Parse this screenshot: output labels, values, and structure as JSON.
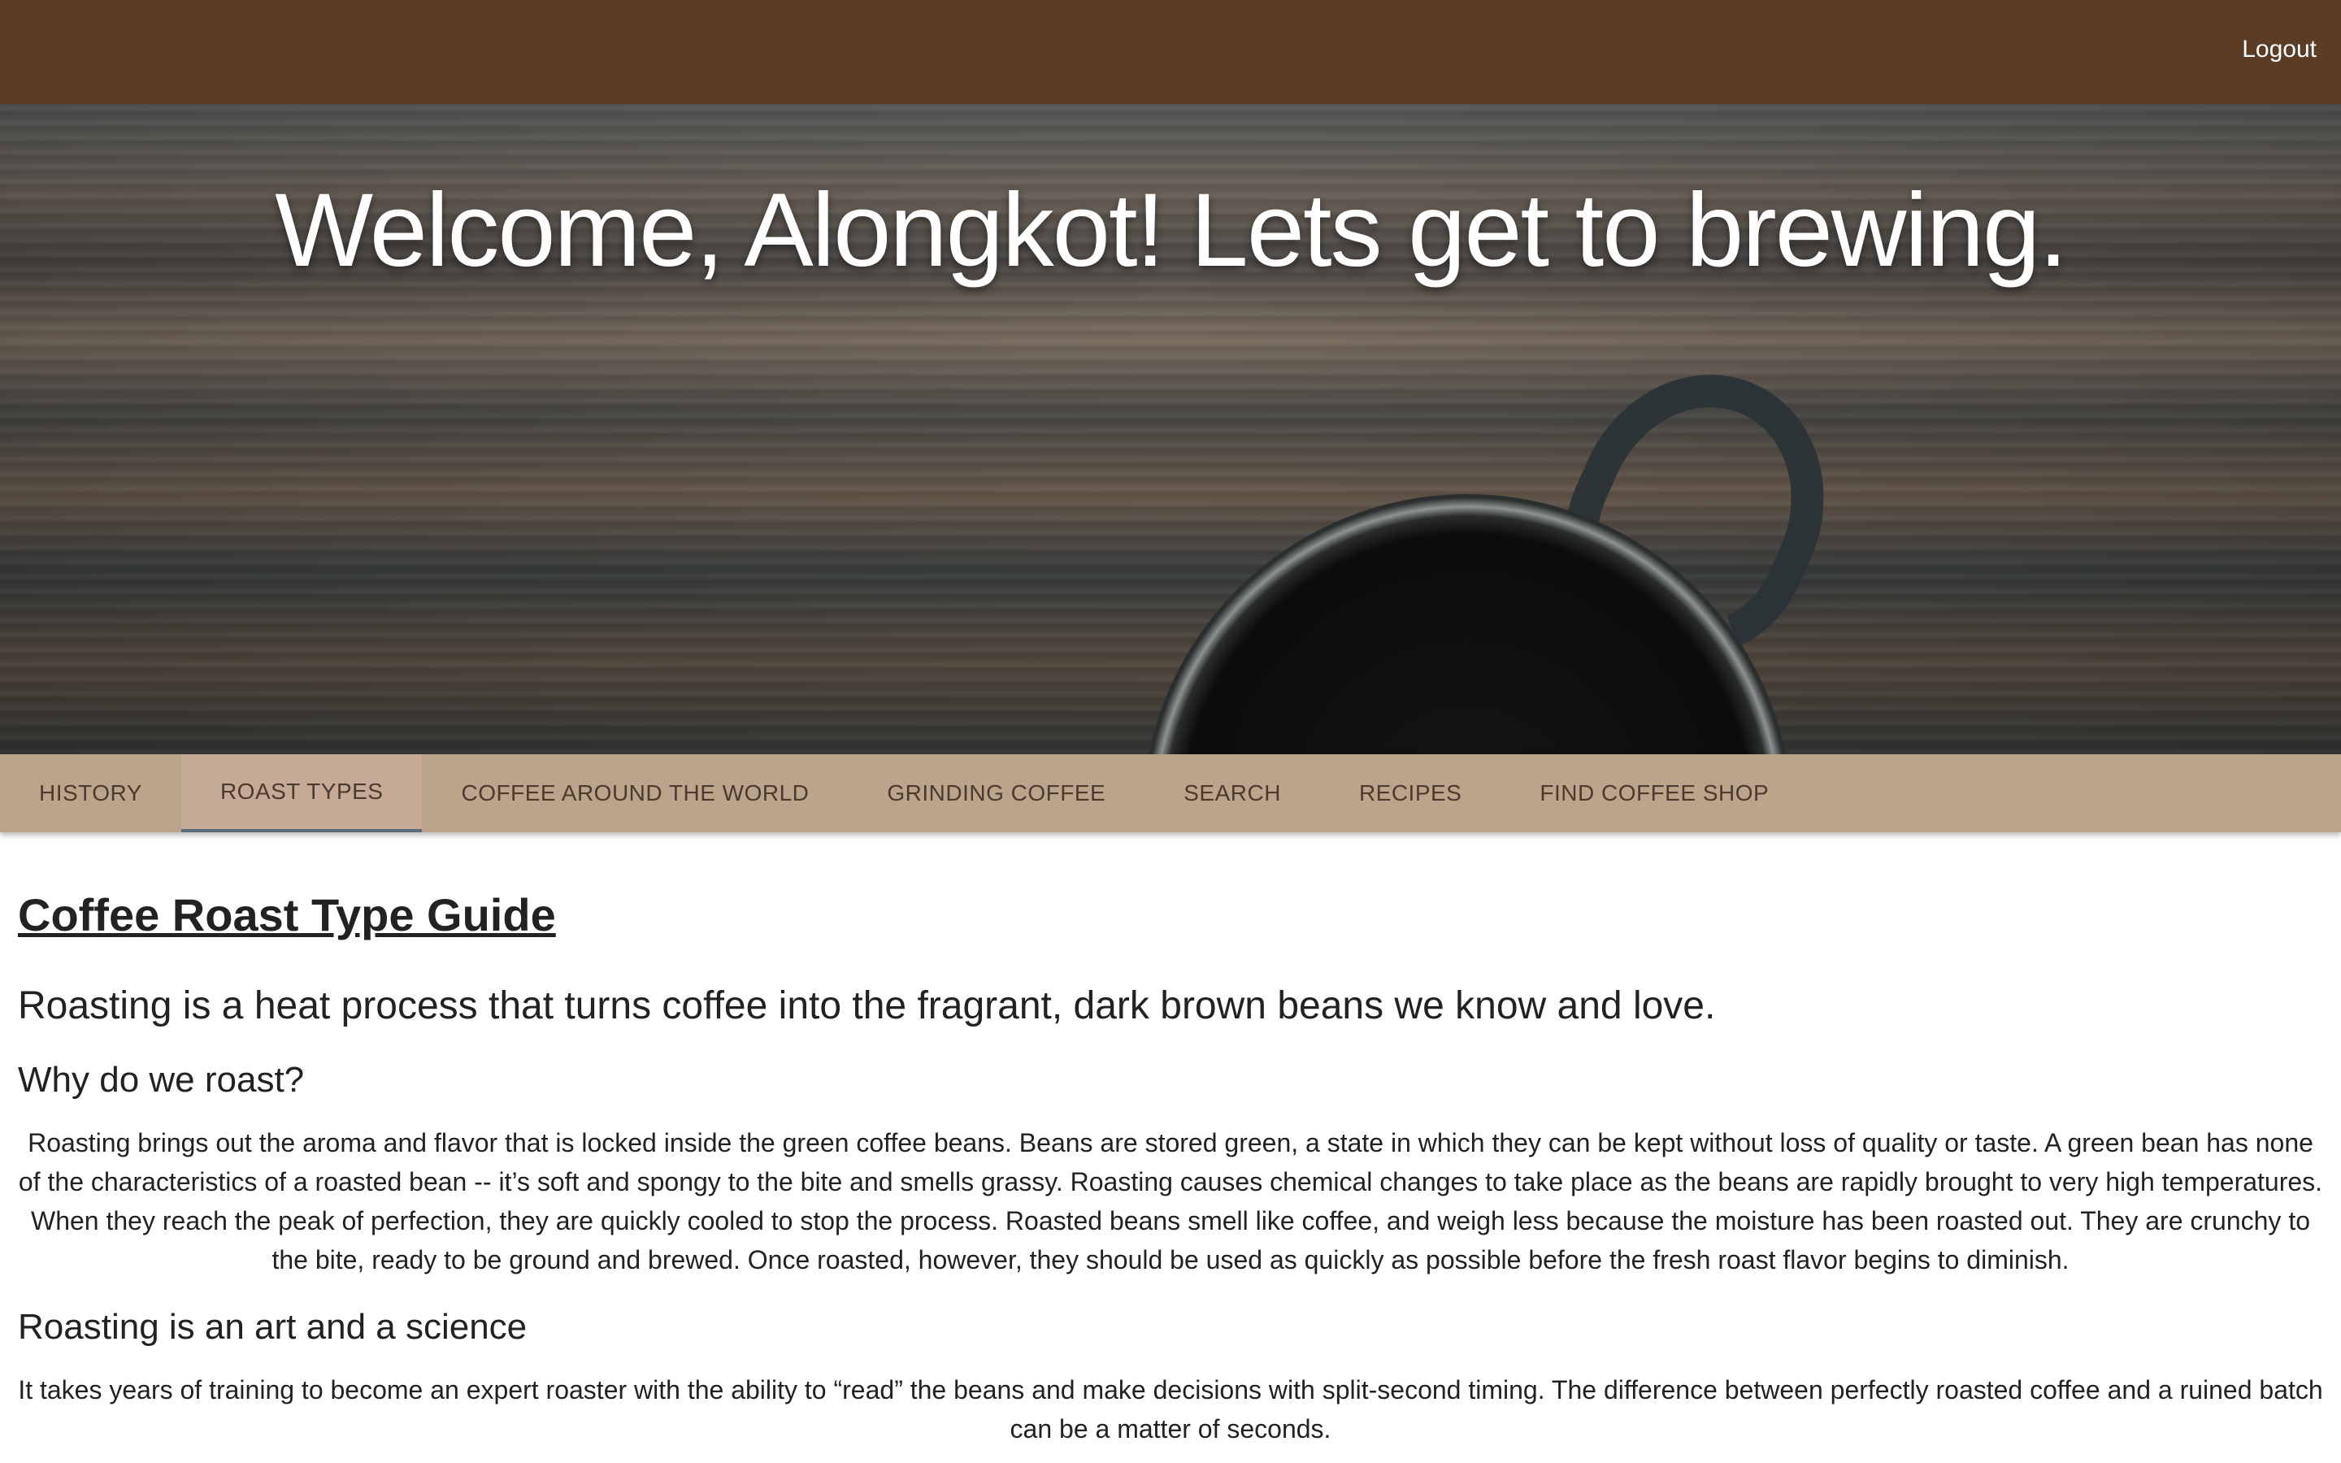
{
  "header": {
    "logout_label": "Logout",
    "background_color": "#5b3d26"
  },
  "hero": {
    "title": "Welcome, Alongkot! Lets get to brewing."
  },
  "nav": {
    "background_color": "#baa48a",
    "active_color": "#c7aa96",
    "tabs": [
      {
        "label": "HISTORY",
        "active": false
      },
      {
        "label": "ROAST TYPES",
        "active": true
      },
      {
        "label": "COFFEE AROUND THE WORLD",
        "active": false
      },
      {
        "label": "GRINDING COFFEE",
        "active": false
      },
      {
        "label": "SEARCH",
        "active": false
      },
      {
        "label": "RECIPES",
        "active": false
      },
      {
        "label": "FIND COFFEE SHOP",
        "active": false
      }
    ]
  },
  "main": {
    "title": "Coffee Roast Type Guide",
    "lead": "Roasting is a heat process that turns coffee into the fragrant, dark brown beans we know and love.",
    "section1_heading": "Why do we roast?",
    "section1_text": "Roasting brings out the aroma and flavor that is locked inside the green coffee beans. Beans are stored green, a state in which they can be kept without loss of quality or taste. A green bean has none of the characteristics of a roasted bean -- it’s soft and spongy to the bite and smells grassy. Roasting causes chemical changes to take place as the beans are rapidly brought to very high temperatures. When they reach the peak of perfection, they are quickly cooled to stop the process. Roasted beans smell like coffee, and weigh less because the moisture has been roasted out. They are crunchy to the bite, ready to be ground and brewed. Once roasted, however, they should be used as quickly as possible before the fresh roast flavor begins to diminish.",
    "section2_heading": "Roasting is an art and a science",
    "section2_text": "It takes years of training to become an expert roaster with the ability to “read” the beans and make decisions with split-second timing. The difference between perfectly roasted coffee and a ruined batch can be a matter of seconds."
  }
}
